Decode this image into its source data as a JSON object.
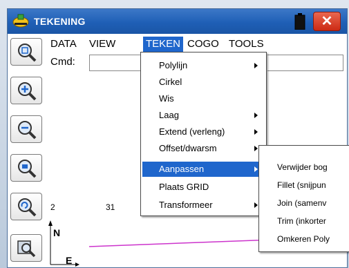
{
  "window": {
    "title": "TEKENING",
    "close_label": "✕"
  },
  "menubar": {
    "items": [
      "DATA",
      "VIEW",
      "TEKEN",
      "COGO",
      "TOOLS"
    ],
    "active": "TEKEN"
  },
  "command": {
    "label": "Cmd:",
    "value": ""
  },
  "canvas": {
    "ruler_labels": [
      "2",
      "31"
    ],
    "axis_labels": {
      "north": "N",
      "east": "E"
    }
  },
  "teken_menu": {
    "items": [
      {
        "label": "Polylijn",
        "submenu": true
      },
      {
        "label": "Cirkel",
        "submenu": false
      },
      {
        "label": "Wis",
        "submenu": false
      },
      {
        "label": "Laag",
        "submenu": true
      },
      {
        "label": "Extend (verleng)",
        "submenu": true
      },
      {
        "label": "Offset/dwarsm",
        "submenu": true
      },
      {
        "label": "Aanpassen",
        "submenu": true,
        "active": true
      },
      {
        "label": "Plaats GRID",
        "submenu": false
      },
      {
        "label": "Transformeer",
        "submenu": true
      }
    ]
  },
  "aanpassen_submenu": {
    "items": [
      "Verwijder bog",
      "Fillet (snijpun",
      "Join (samenv",
      "Trim (inkorter",
      "Omkeren Poly"
    ]
  },
  "toolbar": {
    "icons": [
      "zoom-all-icon",
      "zoom-in-icon",
      "zoom-out-icon",
      "zoom-window-icon",
      "zoom-previous-icon",
      "zoom-extents-icon"
    ]
  },
  "colors": {
    "titlebar": "#1f5fb6",
    "highlight": "#1f66cc",
    "close": "#cc2a14",
    "canvas_line": "#cc33cc"
  }
}
